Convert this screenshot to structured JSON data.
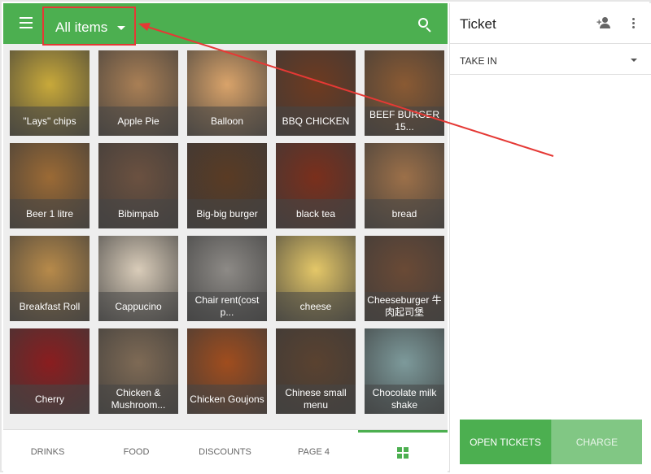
{
  "header": {
    "category_label": "All items",
    "menu_icon": "hamburger-icon",
    "search_icon": "search-icon"
  },
  "items": [
    {
      "label": "\"Lays\" chips",
      "color": "#c8a93a"
    },
    {
      "label": "Apple Pie",
      "color": "#a97f55"
    },
    {
      "label": "Balloon",
      "color": "#d9a36a"
    },
    {
      "label": "BBQ CHICKEN",
      "color": "#6e3a20"
    },
    {
      "label": "BEEF BURGER 15...",
      "color": "#8a5a33"
    },
    {
      "label": "Beer 1 litre",
      "color": "#9b6a35"
    },
    {
      "label": "Bibimpab",
      "color": "#6b5140"
    },
    {
      "label": "Big-big burger",
      "color": "#5a3b24"
    },
    {
      "label": "black tea",
      "color": "#7a2f1c"
    },
    {
      "label": "bread",
      "color": "#9c7049"
    },
    {
      "label": "Breakfast Roll",
      "color": "#b78a4a"
    },
    {
      "label": "Cappucino",
      "color": "#d9ccb9"
    },
    {
      "label": "Chair rent(cost p...",
      "color": "#8d8a86"
    },
    {
      "label": "cheese",
      "color": "#e4c768"
    },
    {
      "label": "Cheeseburger 牛肉起司堡",
      "color": "#6a4a36"
    },
    {
      "label": "Cherry",
      "color": "#8a1d1f"
    },
    {
      "label": "Chicken & Mushroom...",
      "color": "#7e6a55"
    },
    {
      "label": "Chicken Goujons",
      "color": "#a04d1e"
    },
    {
      "label": "Chinese small menu",
      "color": "#5a4230"
    },
    {
      "label": "Chocolate milk shake",
      "color": "#7d9a9b"
    }
  ],
  "bottom_tabs": [
    "DRINKS",
    "FOOD",
    "DISCOUNTS",
    "PAGE 4"
  ],
  "bottom_grid_icon": "grid-icon",
  "ticket": {
    "title": "Ticket",
    "add_customer_icon": "add-person-icon",
    "more_icon": "more-vert-icon",
    "dining_option": "TAKE IN",
    "open_tickets_label": "OPEN TICKETS",
    "charge_label": "CHARGE"
  },
  "colors": {
    "primary": "#4caf50",
    "annotation": "#e53935"
  }
}
